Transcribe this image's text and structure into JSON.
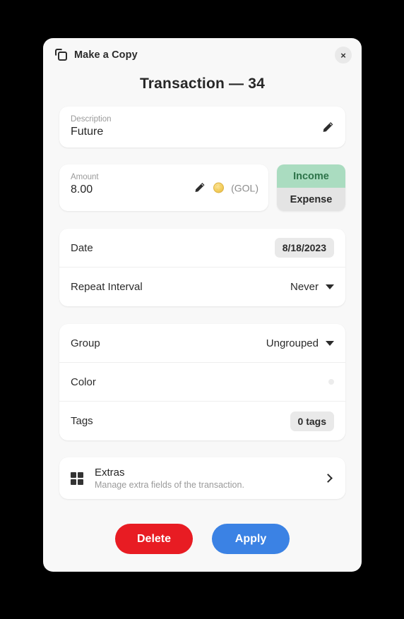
{
  "titlebar": {
    "icon": "copy-icon",
    "label": "Make a Copy",
    "close_label": "×"
  },
  "dialog": {
    "title": "Transaction — 34"
  },
  "description": {
    "label": "Description",
    "value": "Future",
    "edit_icon": "pencil-icon"
  },
  "amount": {
    "label": "Amount",
    "value": "8.00",
    "edit_icon": "pencil-icon",
    "currency_icon": "coin-icon",
    "currency_code": "(GOL)"
  },
  "type_toggle": {
    "income_label": "Income",
    "expense_label": "Expense",
    "selected": "Income",
    "income_bg": "#aadcc0",
    "income_fg": "#2d7349",
    "expense_bg": "#e4e4e4",
    "expense_fg": "#2a2a2a"
  },
  "schedule": {
    "date": {
      "label": "Date",
      "value": "8/18/2023"
    },
    "repeat": {
      "label": "Repeat Interval",
      "value": "Never"
    }
  },
  "grouping": {
    "group": {
      "label": "Group",
      "value": "Ungrouped"
    },
    "color": {
      "label": "Color",
      "value": "#3b82e4"
    },
    "tags": {
      "label": "Tags",
      "value": "0 tags"
    }
  },
  "extras": {
    "icon": "grid-icon",
    "title": "Extras",
    "subtitle": "Manage extra fields of the transaction.",
    "chevron": "chevron-right-icon"
  },
  "footer": {
    "delete_label": "Delete",
    "apply_label": "Apply",
    "delete_color": "#e81c23",
    "apply_color": "#3b82e4"
  }
}
